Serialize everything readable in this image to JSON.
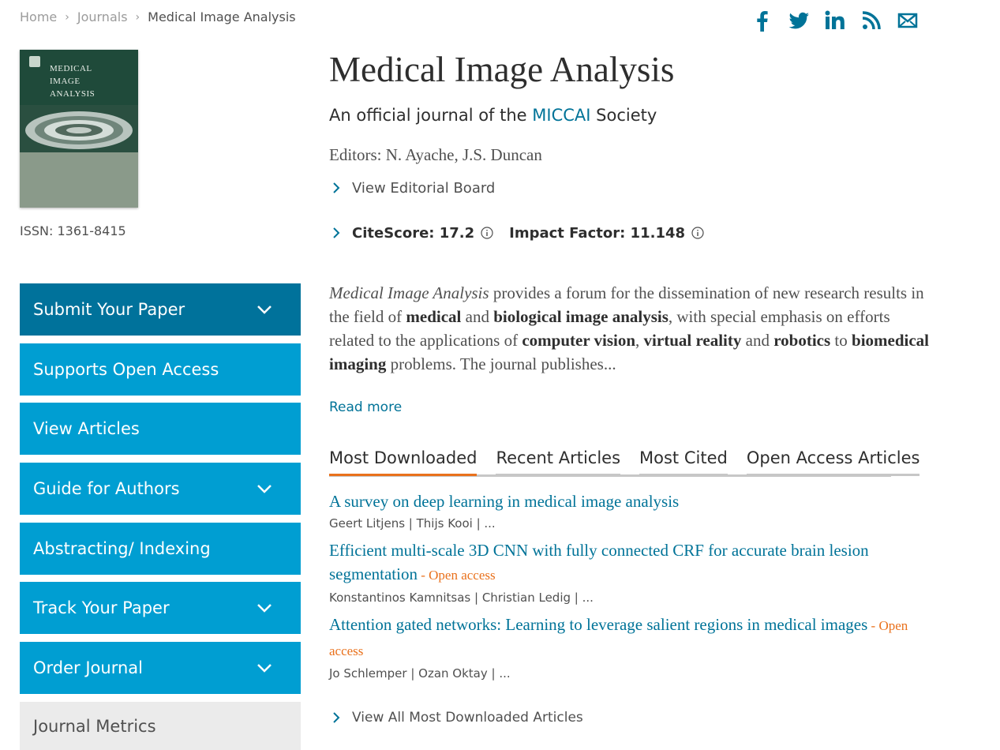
{
  "breadcrumb": {
    "home": "Home",
    "journals": "Journals",
    "current": "Medical Image Analysis"
  },
  "social": [
    "facebook-icon",
    "twitter-icon",
    "linkedin-icon",
    "rss-icon",
    "email-icon"
  ],
  "colors": {
    "accent": "#007398",
    "sidebar": "#009ed2",
    "sidebar_active": "#00729b",
    "orange": "#e9711c"
  },
  "cover": {
    "title_lines": [
      "MEDICAL",
      "IMAGE",
      "ANALYSIS"
    ]
  },
  "issn": "ISSN: 1361-8415",
  "journal": {
    "title": "Medical Image Analysis",
    "subtitle_pre": "An official journal of the ",
    "subtitle_link": "MICCAI",
    "subtitle_post": " Society",
    "editors": "Editors: N. Ayache, J.S. Duncan",
    "editorial_board": "View Editorial Board",
    "citescore": "CiteScore: 17.2",
    "impact_factor": "Impact Factor: 11.148"
  },
  "description": {
    "lead": "Medical Image Analysis",
    "t1": " provides a forum for the dissemination of new research results in the field of ",
    "b1": "medical",
    "t2": " and ",
    "b2": "biological image analysis",
    "t3": ", with special emphasis on efforts related to the applications of ",
    "b3": "computer vision",
    "t4": ", ",
    "b4": "virtual reality",
    "t5": " and ",
    "b5": "robotics",
    "t6": " to ",
    "b6": "biomedical imaging",
    "t7": " problems. The journal publishes...",
    "read_more": "Read more"
  },
  "tabs": [
    "Most Downloaded",
    "Recent Articles",
    "Most Cited",
    "Open Access Articles"
  ],
  "articles": [
    {
      "title": "A survey on deep learning in medical image analysis",
      "oa": "",
      "authors": "Geert Litjens | Thijs Kooi | ..."
    },
    {
      "title": "Efficient multi-scale 3D CNN with fully connected CRF for accurate brain lesion segmentation",
      "oa": " - Open access",
      "authors": "Konstantinos Kamnitsas | Christian Ledig | ..."
    },
    {
      "title": "Attention gated networks: Learning to leverage salient regions in medical images",
      "oa": " - Open access",
      "authors": "Jo Schlemper | Ozan Oktay | ..."
    }
  ],
  "view_all": "View All Most Downloaded Articles",
  "sidebar": [
    {
      "label": "Submit Your Paper",
      "expandable": true
    },
    {
      "label": "Supports Open Access",
      "expandable": false
    },
    {
      "label": "View Articles",
      "expandable": false
    },
    {
      "label": "Guide for Authors",
      "expandable": true
    },
    {
      "label": "Abstracting/ Indexing",
      "expandable": false
    },
    {
      "label": "Track Your Paper",
      "expandable": true
    },
    {
      "label": "Order Journal",
      "expandable": true
    },
    {
      "label": "Journal Metrics",
      "expandable": false
    }
  ]
}
